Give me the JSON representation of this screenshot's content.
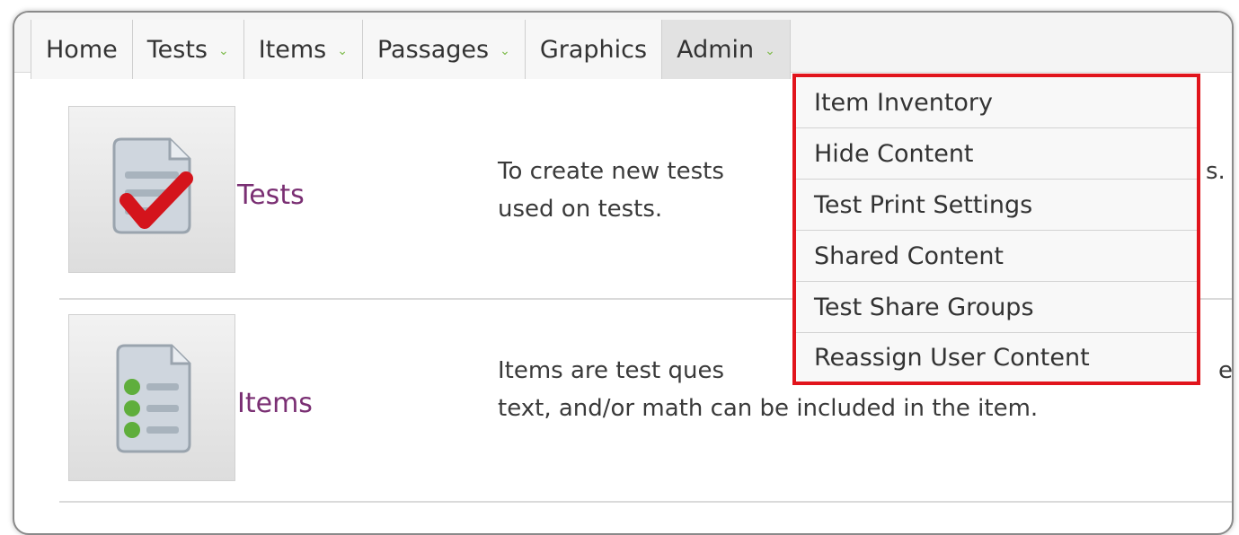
{
  "nav": {
    "items": [
      {
        "label": "Home",
        "has_chevron": false
      },
      {
        "label": "Tests",
        "has_chevron": true
      },
      {
        "label": "Items",
        "has_chevron": true
      },
      {
        "label": "Passages",
        "has_chevron": true
      },
      {
        "label": "Graphics",
        "has_chevron": false
      },
      {
        "label": "Admin",
        "has_chevron": true
      }
    ],
    "chevron_glyph": "⌄",
    "active": "Admin"
  },
  "admin_menu": {
    "items": [
      "Item Inventory",
      "Hide Content",
      "Test Print Settings",
      "Shared Content",
      "Test Share Groups",
      "Reassign User Content"
    ],
    "highlight_color": "#e1141c"
  },
  "sections": [
    {
      "title": "Tests",
      "icon": "test-checklist-icon",
      "description_lines": [
        "To create new tests",
        "used on tests."
      ],
      "description_tail": "s."
    },
    {
      "title": "Items",
      "icon": "item-checklist-icon",
      "description_lines": [
        "Items are test ques",
        "text, and/or math can be included in the item."
      ],
      "description_tail": "e"
    }
  ],
  "colors": {
    "link": "#7a2f73",
    "chevron": "#7dbb4a",
    "check": "#d4141c"
  }
}
